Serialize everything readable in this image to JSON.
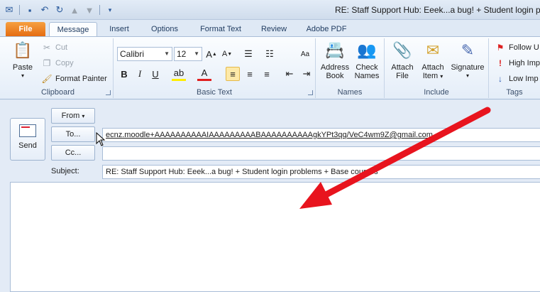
{
  "window": {
    "title": "RE: Staff Support Hub: Eeek...a bug! + Student login pro"
  },
  "tabs": [
    {
      "label": "File",
      "active": false
    },
    {
      "label": "Message",
      "active": true
    },
    {
      "label": "Insert",
      "active": false
    },
    {
      "label": "Options",
      "active": false
    },
    {
      "label": "Format Text",
      "active": false
    },
    {
      "label": "Review",
      "active": false
    },
    {
      "label": "Adobe PDF",
      "active": false
    }
  ],
  "ribbon": {
    "clipboard": {
      "label": "Clipboard",
      "paste": "Paste",
      "cut": "Cut",
      "copy": "Copy",
      "format_painter": "Format Painter"
    },
    "basic_text": {
      "label": "Basic Text",
      "font": "Calibri",
      "size": "12"
    },
    "names": {
      "label": "Names",
      "address_book_1": "Address",
      "address_book_2": "Book",
      "check_names_1": "Check",
      "check_names_2": "Names"
    },
    "include": {
      "label": "Include",
      "attach_file_1": "Attach",
      "attach_file_2": "File",
      "attach_item_1": "Attach",
      "attach_item_2": "Item",
      "signature": "Signature"
    },
    "tags": {
      "label": "Tags",
      "follow_up": "Follow U",
      "high_importance": "High Imp",
      "low_importance": "Low Imp"
    }
  },
  "compose": {
    "send": "Send",
    "from": "From",
    "to": "To...",
    "cc": "Cc...",
    "subject_label": "Subject:",
    "to_value": "ecnz.moodle+AAAAAAAAAAIAAAAAAAAABAAAAAAAAAAgkYPt3qq/VeC4wm9Z@gmail.com",
    "cc_value": "",
    "subject_value": "RE: Staff Support Hub: Eeek...a bug! + Student login problems + Base courses"
  },
  "colors": {
    "file_tab": "#e46a10",
    "arrow": "#e8141e",
    "highlight": "#fde9a8"
  }
}
